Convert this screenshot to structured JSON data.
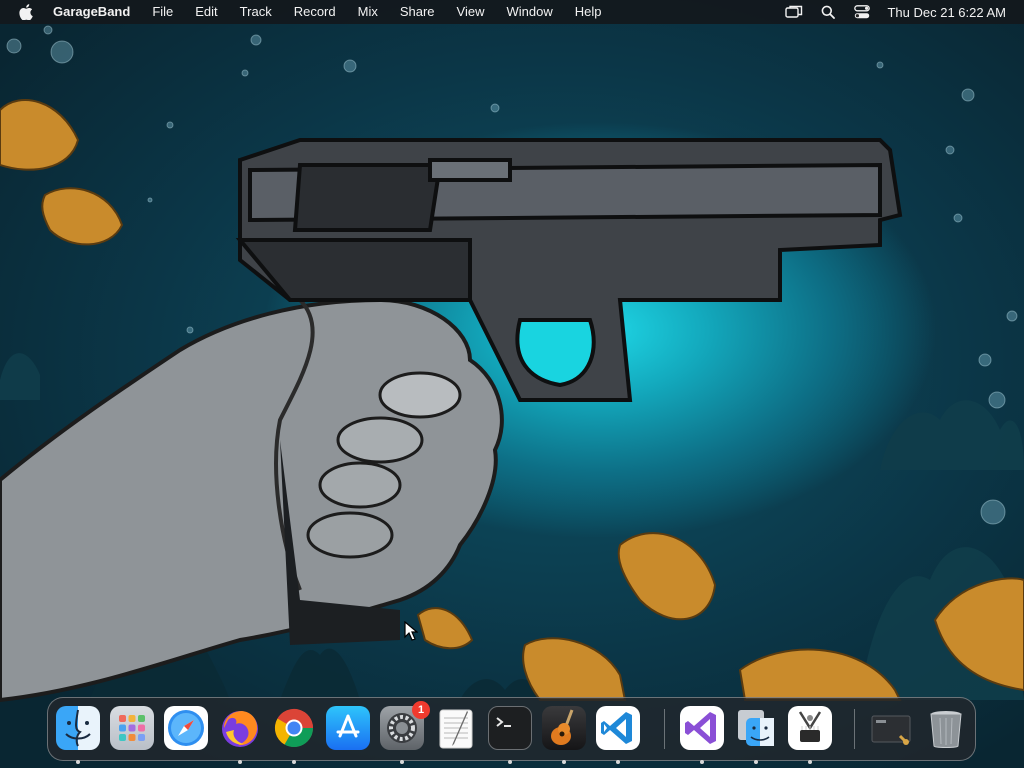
{
  "menubar": {
    "app_name": "GarageBand",
    "menus": [
      "File",
      "Edit",
      "Track",
      "Record",
      "Mix",
      "Share",
      "View",
      "Window",
      "Help"
    ],
    "clock": "Thu Dec 21  6:22 AM"
  },
  "dock": {
    "items": [
      {
        "name": "Finder",
        "icon": "finder-icon",
        "running": true
      },
      {
        "name": "Launchpad",
        "icon": "launchpad-icon",
        "running": false
      },
      {
        "name": "Safari",
        "icon": "safari-icon",
        "running": false
      },
      {
        "name": "Firefox",
        "icon": "firefox-icon",
        "running": true
      },
      {
        "name": "Google Chrome",
        "icon": "chrome-icon",
        "running": true
      },
      {
        "name": "App Store",
        "icon": "app-store-icon",
        "running": false
      },
      {
        "name": "System Settings",
        "icon": "system-settings-icon",
        "running": true,
        "badge": "1"
      },
      {
        "name": "TextEdit",
        "icon": "textedit-icon",
        "running": false
      },
      {
        "name": "Terminal",
        "icon": "terminal-icon",
        "running": true
      },
      {
        "name": "GarageBand",
        "icon": "garageband-icon",
        "running": true
      },
      {
        "name": "Visual Studio Code",
        "icon": "vscode-icon",
        "running": true
      },
      {
        "name": "Visual Studio",
        "icon": "visual-studio-icon",
        "running": true
      },
      {
        "name": "Finder Documents",
        "icon": "finder-docs-icon",
        "running": true
      },
      {
        "name": "System Information",
        "icon": "system-information-icon",
        "running": true
      },
      {
        "name": "Downloads Stack",
        "icon": "downloads-stack-icon",
        "running": false
      },
      {
        "name": "Trash",
        "icon": "trash-icon",
        "running": false
      }
    ]
  },
  "colors": {
    "menubar_bg": "#14181c",
    "badge_red": "#f03a2e"
  }
}
